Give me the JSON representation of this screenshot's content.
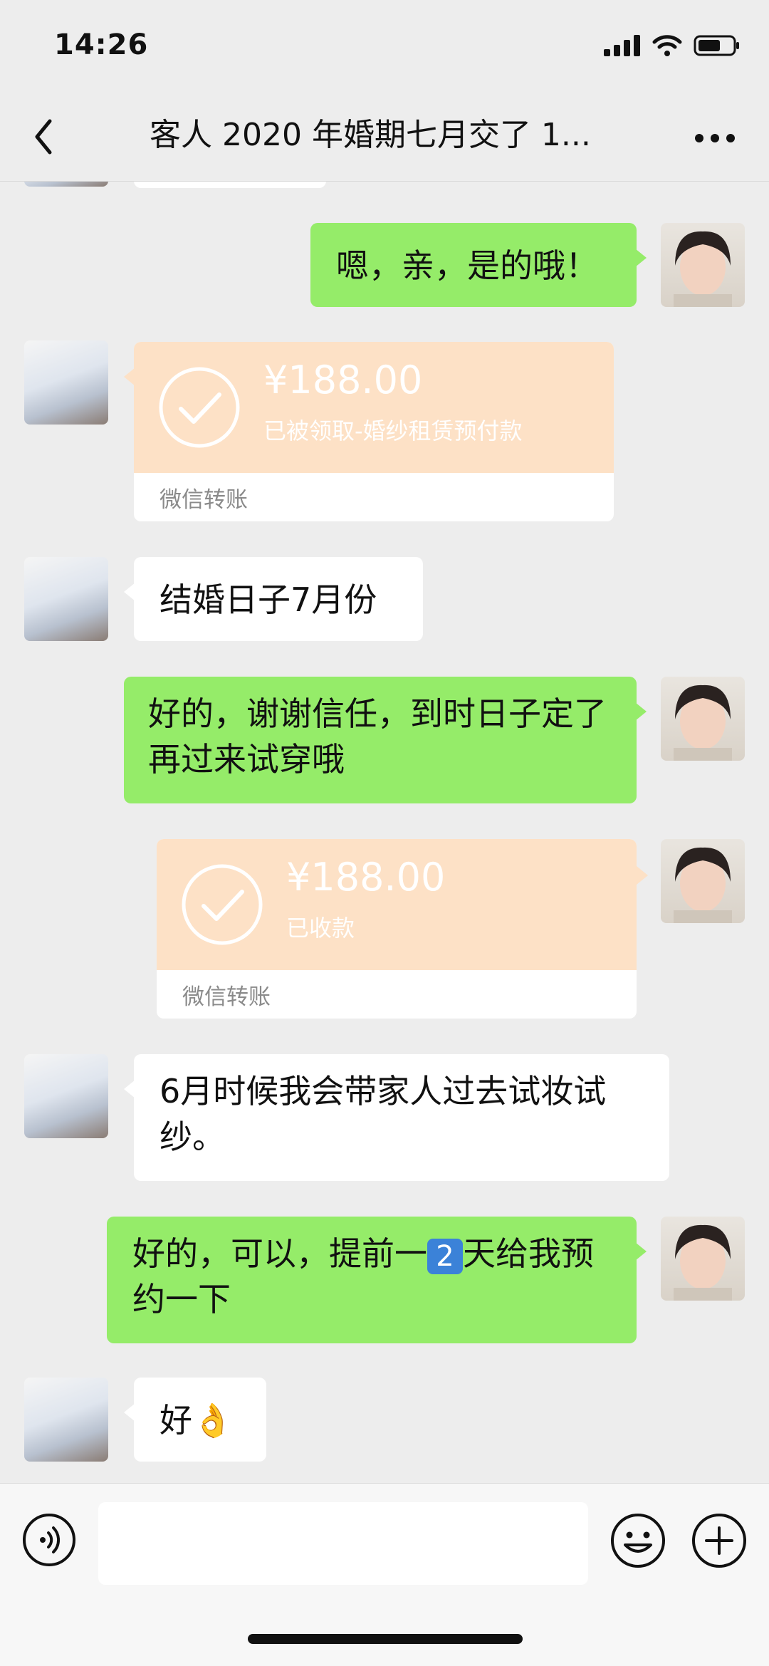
{
  "status_bar": {
    "time": "14:26"
  },
  "nav": {
    "title": "客人 2020 年婚期七月交了 1..."
  },
  "messages": [
    {
      "text": "嗯，亲，是的哦！"
    },
    {
      "amount": "¥188.00",
      "note": "已被领取-婚纱租赁预付款",
      "footer": "微信转账"
    },
    {
      "text": "结婚日子7月份"
    },
    {
      "text": "好的，谢谢信任，到时日子定了再过来试穿哦"
    },
    {
      "amount": "¥188.00",
      "note": "已收款",
      "footer": "微信转账"
    },
    {
      "text": "6月时候我会带家人过去试妆试纱。"
    },
    {
      "text_before": "好的，可以，提前一",
      "emoji": "2",
      "text_after": "天给我预约一下"
    },
    {
      "text": "好",
      "emoji": "👌"
    }
  ]
}
